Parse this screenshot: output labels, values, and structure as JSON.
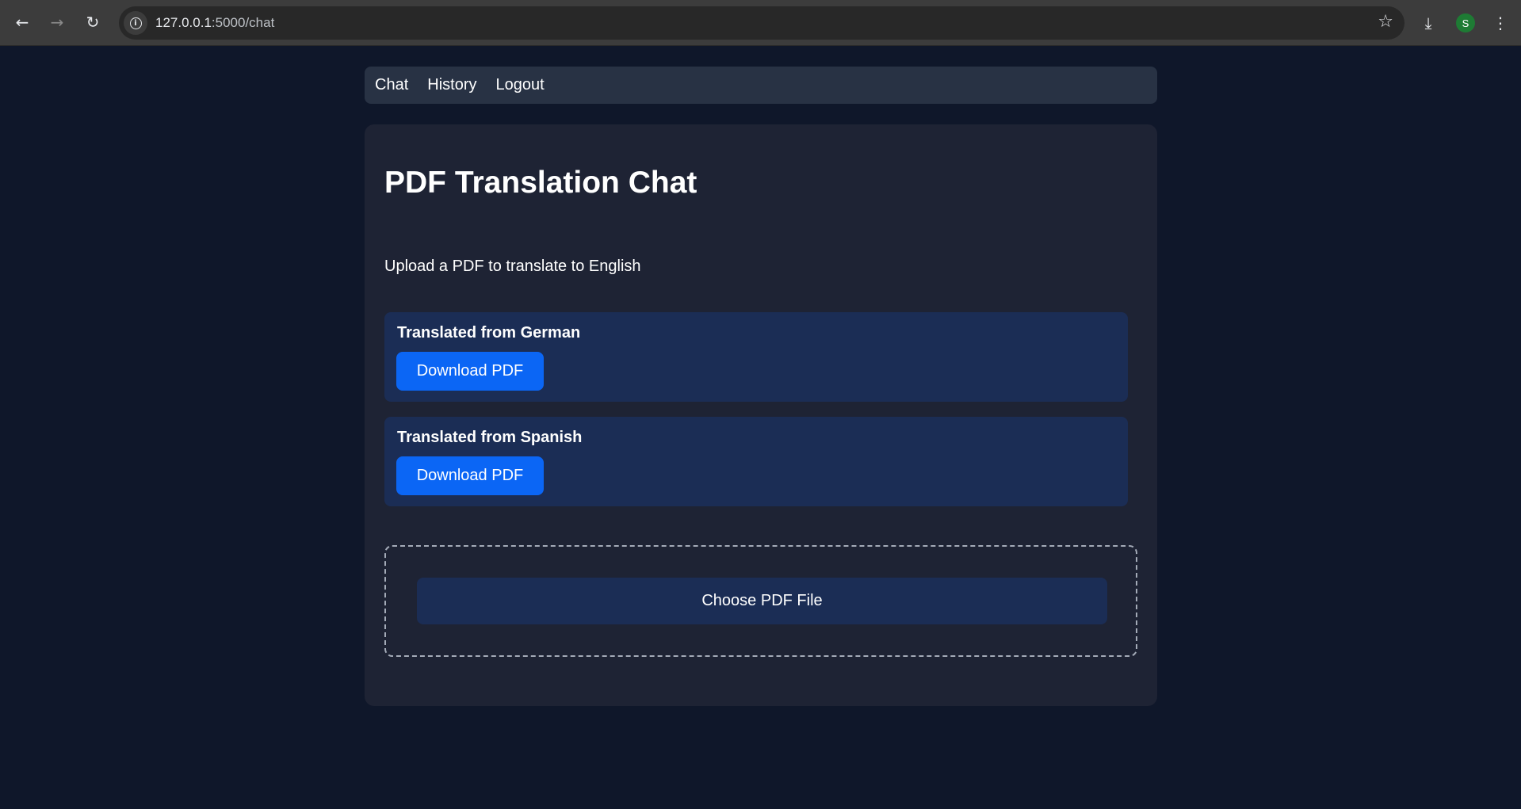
{
  "browser": {
    "url_host": "127.0.0.1",
    "url_path": ":5000/chat",
    "avatar_letter": "S",
    "icons": {
      "back": "back-arrow-icon",
      "forward": "forward-arrow-icon",
      "reload": "reload-icon",
      "site_info": "info-icon",
      "bookmark": "star-icon",
      "downloads": "download-icon",
      "menu": "kebab-menu-icon"
    }
  },
  "nav": {
    "items": [
      {
        "label": "Chat"
      },
      {
        "label": "History"
      },
      {
        "label": "Logout"
      }
    ]
  },
  "main": {
    "title": "PDF Translation Chat",
    "subtitle": "Upload a PDF to translate to English",
    "messages": [
      {
        "title": "Translated from German",
        "button": "Download PDF"
      },
      {
        "title": "Translated from Spanish",
        "button": "Download PDF"
      }
    ],
    "upload_label": "Choose PDF File"
  },
  "colors": {
    "page_bg": "#0f172a",
    "card_bg": "#1e2334",
    "nav_bg": "#283244",
    "message_bg": "#1b2d55",
    "button_blue": "#0b66f5"
  }
}
